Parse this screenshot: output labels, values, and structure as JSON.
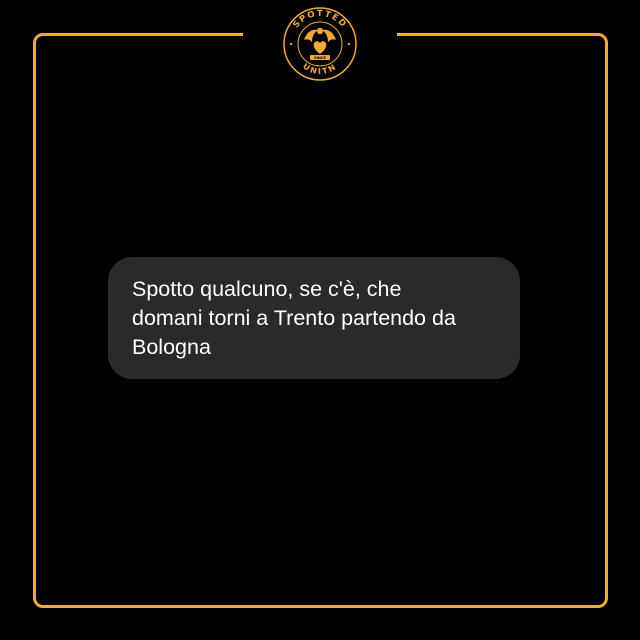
{
  "logo": {
    "top_text": "SPOTTED",
    "bottom_text": "UNITN",
    "ribbon_text": "SINCE",
    "icon": "eagle-heart-emblem-icon",
    "accent_color": "#f2a93b"
  },
  "post": {
    "message": "Spotto qualcuno, se c'è, che\ndomani torni a Trento partendo da\nBologna",
    "bubble_color": "#2a2a2a",
    "text_color": "#ffffff"
  },
  "background_color": "#000000"
}
